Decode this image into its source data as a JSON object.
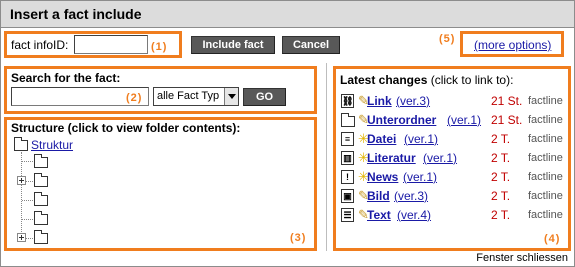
{
  "dialog": {
    "title": "Insert a fact include",
    "close_label": "Fenster schliessen"
  },
  "top": {
    "infoid_label": "fact infoID:",
    "infoid_value": "",
    "marker_1": "(1)",
    "include_button": "Include fact",
    "cancel_button": "Cancel",
    "marker_5": "(5)",
    "more_options": "(more options)"
  },
  "search": {
    "heading": "Search for the fact:",
    "query_value": "",
    "marker_2": "(2)",
    "type_selected": "alle Fact Typ",
    "go_button": "GO"
  },
  "structure": {
    "heading": "Structure (click to view folder contents):",
    "root_label": "Struktur",
    "marker_3": "(3)"
  },
  "latest": {
    "heading": "Latest changes",
    "subheading": "(click to link to):",
    "marker_4": "(4)",
    "items": [
      {
        "icon": "link-icon",
        "glyph": "⛓",
        "name": "Link",
        "version": "ver.3",
        "age": "21 St.",
        "user": "factline"
      },
      {
        "icon": "folder-icon",
        "glyph": "",
        "name": "Unterordner",
        "version": "ver.1",
        "age": "21 St.",
        "user": "factline"
      },
      {
        "icon": "file-icon",
        "glyph": "≡",
        "name": "Datei",
        "version": "ver.1",
        "age": "2 T.",
        "user": "factline"
      },
      {
        "icon": "book-icon",
        "glyph": "▥",
        "name": "Literatur",
        "version": "ver.1",
        "age": "2 T.",
        "user": "factline"
      },
      {
        "icon": "news-icon",
        "glyph": "!",
        "name": "News",
        "version": "ver.1",
        "age": "2 T.",
        "user": "factline"
      },
      {
        "icon": "image-icon",
        "glyph": "▣",
        "name": "Bild",
        "version": "ver.3",
        "age": "2 T.",
        "user": "factline"
      },
      {
        "icon": "text-icon",
        "glyph": "☰",
        "name": "Text",
        "version": "ver.4",
        "age": "2 T.",
        "user": "factline"
      }
    ]
  },
  "colors": {
    "highlight": "#f07d1e",
    "link": "#1a1aa6",
    "age": "#c00000"
  }
}
